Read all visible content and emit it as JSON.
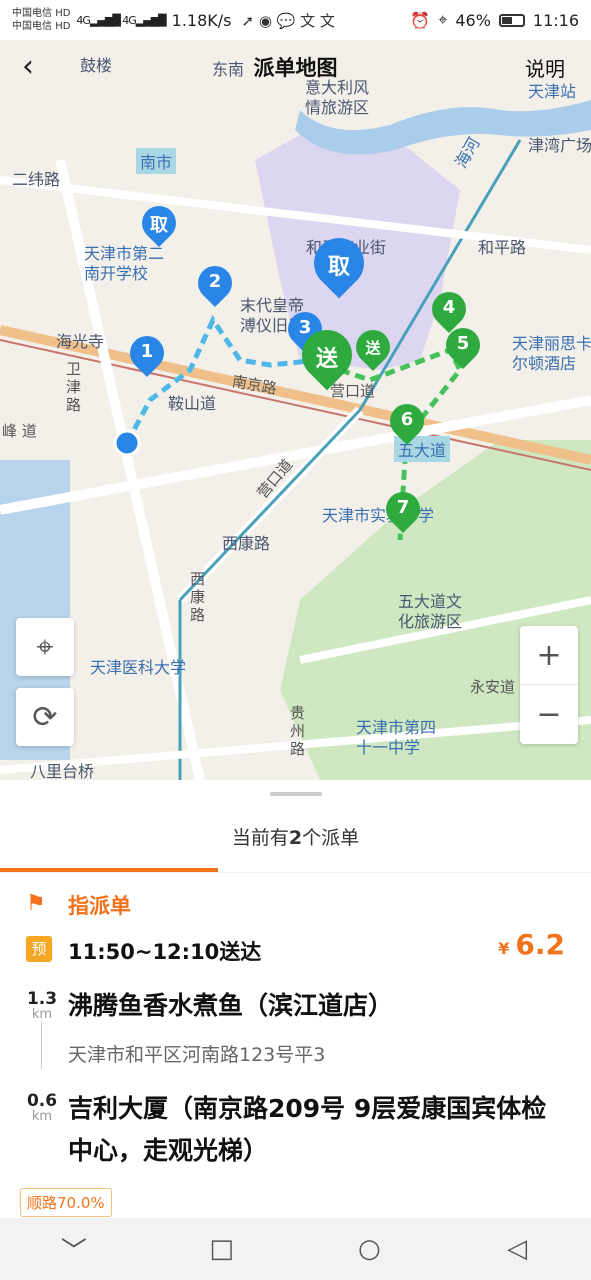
{
  "status_bar": {
    "carrier1": "中国电信",
    "carrier2": "中国电信",
    "hd": "HD",
    "speed": "1.18K/s",
    "battery": "46%",
    "time": "11:16"
  },
  "header": {
    "title": "派单地图",
    "help": "说明"
  },
  "map": {
    "labels": {
      "gulou": "鼓楼",
      "dongnan": "东南",
      "italy": "意大利风\n情旅游区",
      "tianjin_station": "天津站",
      "haihe": "海河",
      "jinwan": "津湾广场",
      "nanshi": "南市",
      "erwei": "二纬路",
      "school2": "天津市第二\n南开学校",
      "heping_shop": "和平商业街",
      "heping_rd": "和平路",
      "haiguang": "海光寺",
      "modai": "末代皇帝\n溥仪旧居",
      "ritz": "天津丽思卡\n尔顿酒店",
      "weijin": "卫\n津\n路",
      "anshan": "鞍山道",
      "nanjing": "南京路",
      "yingkou": "营口道",
      "wudadao": "五大道",
      "feng": "峰 道",
      "yingkou2": "营口道",
      "zhongxue": "天津市实验中学",
      "xikang": "西康路",
      "xikang2": "西\n康\n路",
      "wuda_tour": "五大道文\n化旅游区",
      "yike": "天津医科大学",
      "yongan": "永安道",
      "guizhou": "贵\n州\n路",
      "school41": "天津市第四\n十一中学",
      "balitai": "八里台桥"
    },
    "pins": {
      "qu_big": "取",
      "qu_small": "取",
      "song_big": "送",
      "song_small": "送",
      "p1": "1",
      "p2": "2",
      "p3": "3",
      "p4": "4",
      "p5": "5",
      "p6": "6",
      "p7": "7"
    },
    "controls": {
      "locate": "⌖",
      "refresh": "⟳",
      "zoom_in": "+",
      "zoom_out": "−"
    }
  },
  "panel": {
    "count_prefix": "当前有",
    "count_num": "2",
    "count_suffix": "个派单",
    "tag": "指派单",
    "pre_badge": "预",
    "time_window": "11:50~12:10送达",
    "currency": "¥",
    "price": "6.2",
    "dist1_num": "1.3",
    "dist1_unit": "km",
    "shop_name": "沸腾鱼香水煮鱼（滨江道店）",
    "shop_addr": "天津市和平区河南路123号平3",
    "dist2_num": "0.6",
    "dist2_unit": "km",
    "destination": "吉利大厦（南京路209号 9层爱康国宾体检中心，走观光梯）",
    "route_badge": "顺路70.0%"
  },
  "navbar": {
    "back": "﹀",
    "home": "○",
    "recent": "□",
    "prev": "◁"
  },
  "colors": {
    "accent": "#f2731c",
    "pin_blue": "#2a86e6",
    "pin_green": "#2eaa3e"
  }
}
